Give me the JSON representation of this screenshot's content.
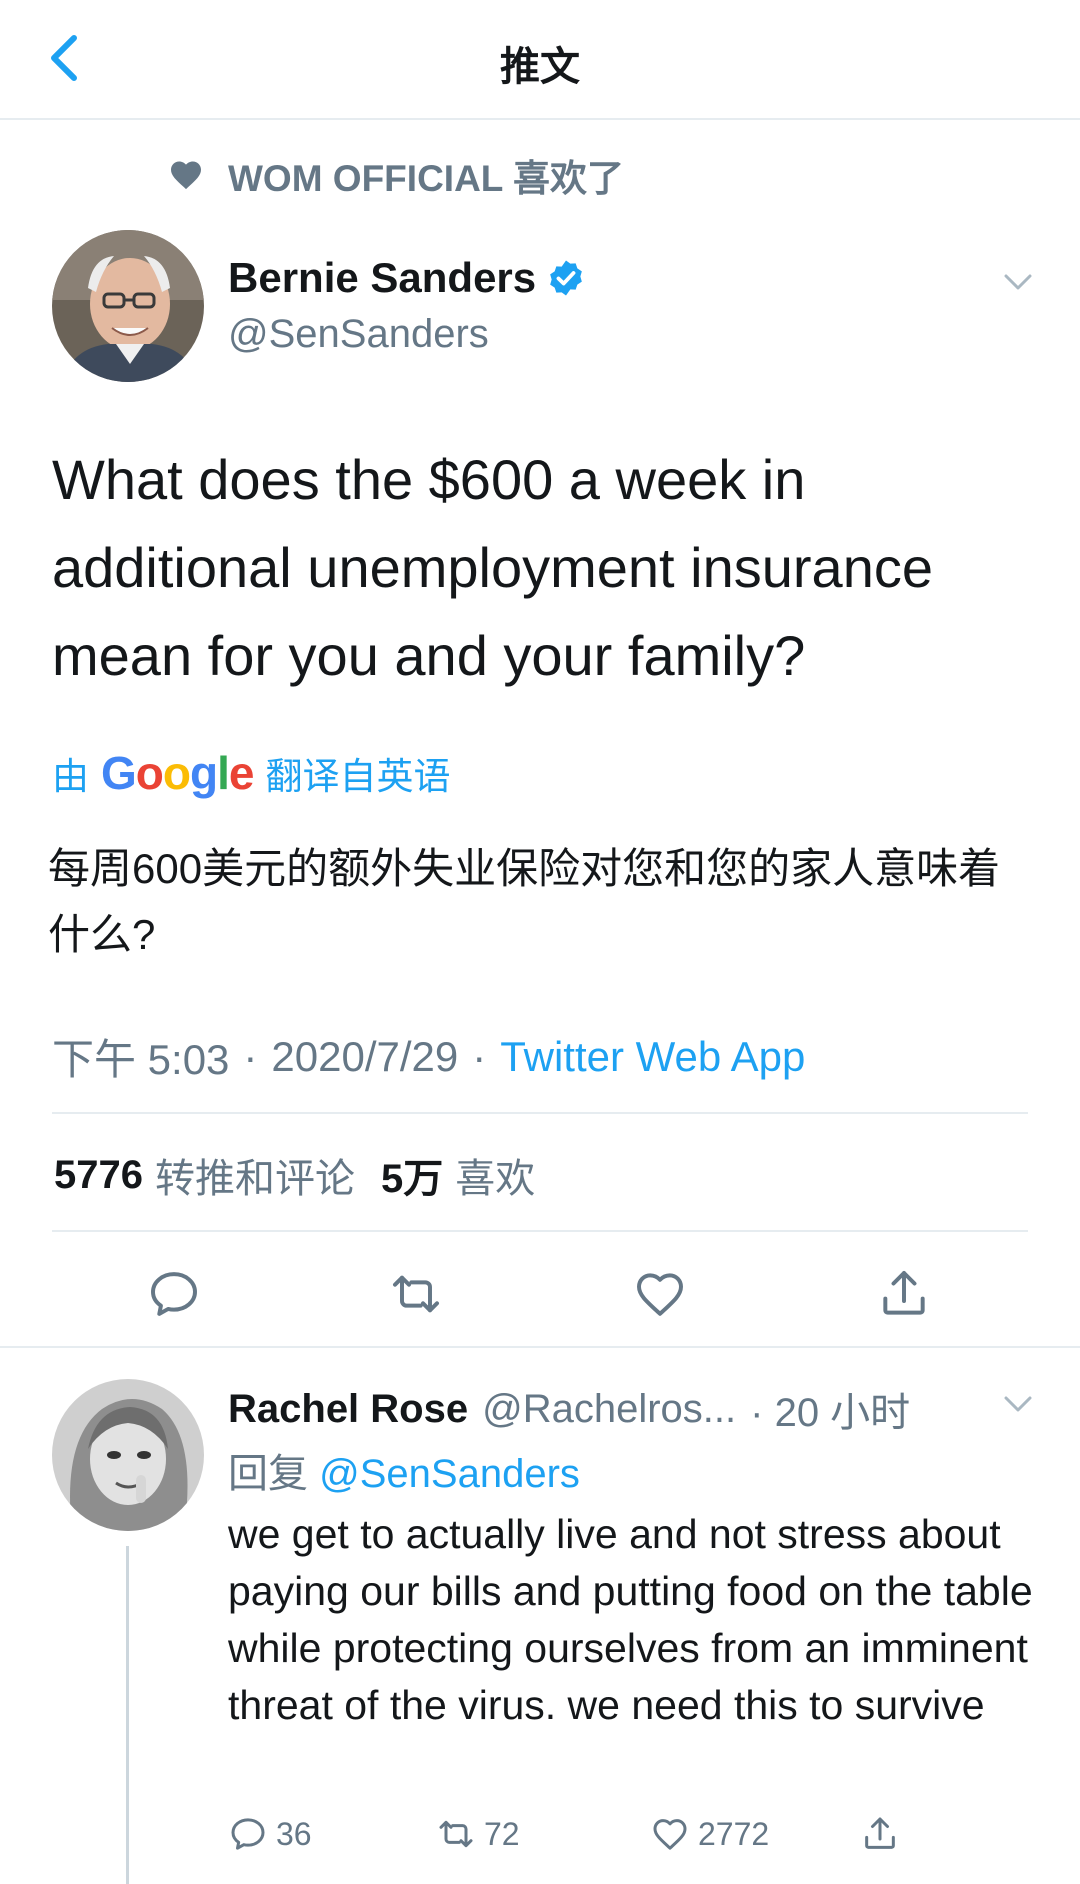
{
  "nav": {
    "title": "推文",
    "back_icon": "chevron-left-icon"
  },
  "social_context": {
    "text": "WOM OFFICIAL 喜欢了",
    "icon": "heart-icon"
  },
  "tweet": {
    "author_name": "Bernie Sanders",
    "author_handle": "@SenSanders",
    "verified": true,
    "text": "What does the $600 a week in additional unemployment insurance mean for you and your family?",
    "translate_prefix": "由",
    "translate_brand": "Google",
    "translate_suffix": "翻译自英语",
    "translated_text": "每周600美元的额外失业保险对您和您的家人意味着什么?",
    "time": "下午 5:03",
    "separator": "·",
    "date": "2020/7/29",
    "source": "Twitter Web App",
    "retweets_count": "5776",
    "retweets_label": "转推和评论",
    "likes_count": "5万",
    "likes_label": "喜欢"
  },
  "reply": {
    "author_name": "Rachel Rose",
    "author_handle": "@Rachelros...",
    "time": "· 20 小时",
    "reply_prefix": "回复",
    "reply_to": "@SenSanders",
    "text": "we get to actually live and not stress about paying our bills and putting food on the table while protecting ourselves from an imminent threat of the virus. we need this to survive",
    "reply_count": "36",
    "retweet_count": "72",
    "like_count": "2772"
  },
  "colors": {
    "accent": "#1da1f2",
    "secondary_text": "#657786",
    "divider": "#e6ecf0"
  }
}
